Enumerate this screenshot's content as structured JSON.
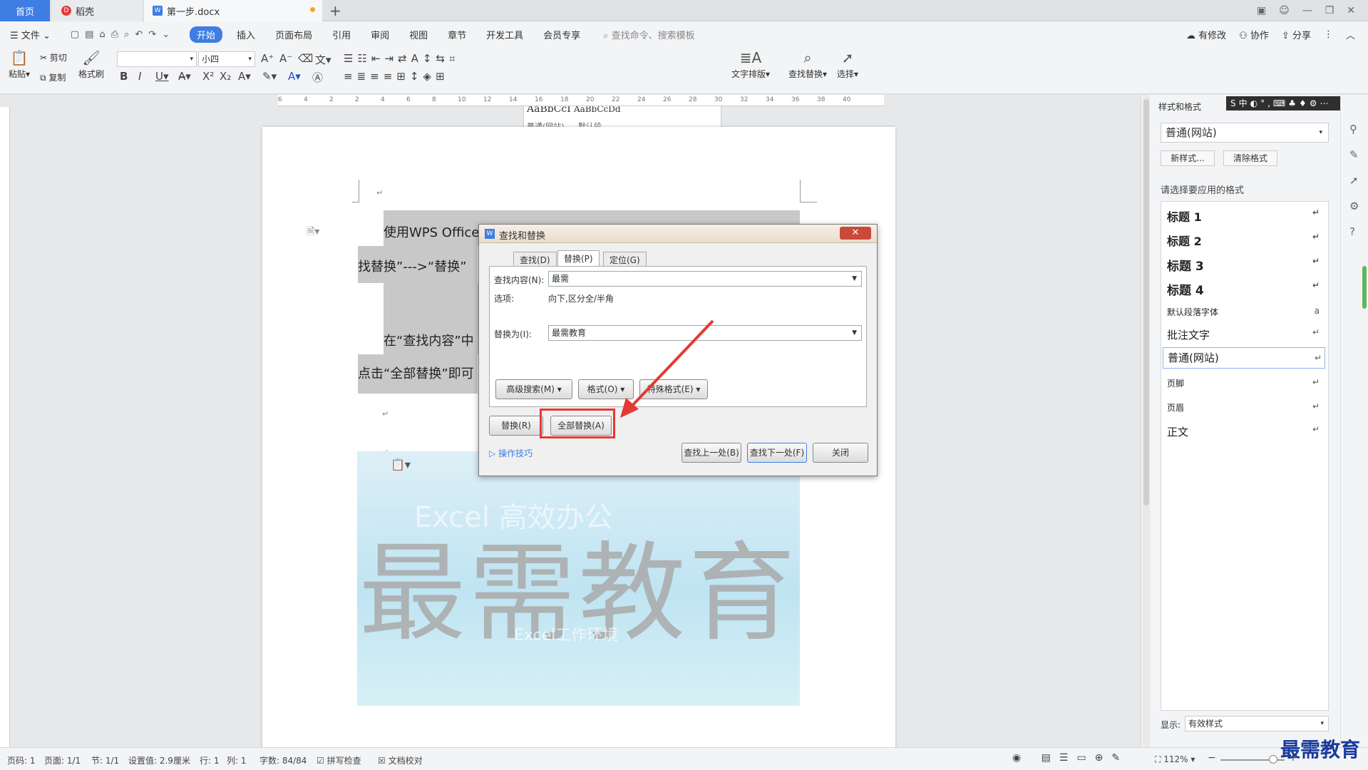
{
  "tabs": {
    "home": "首页",
    "daoke": "稻壳",
    "doc": "第一步.docx",
    "new_tab": "+"
  },
  "menu": {
    "file": "文件",
    "items": [
      "开始",
      "插入",
      "页面布局",
      "引用",
      "审阅",
      "视图",
      "章节",
      "开发工具",
      "会员专享"
    ],
    "search": "查找命令、搜索模板",
    "right": [
      "有修改",
      "协作",
      "分享"
    ]
  },
  "ribbon": {
    "paste": "粘贴",
    "cut": "剪切",
    "copy": "复制",
    "format_painter": "格式刷",
    "font_size": "小四",
    "style_samples": [
      {
        "sample": "AaBbCcI",
        "label": "普通(网站)"
      },
      {
        "sample": "AaBbCcDd",
        "label": "默认段..."
      }
    ],
    "text_layout": "文字排版",
    "find_replace": "查找替换",
    "select": "选择"
  },
  "ruler": [
    "6",
    "4",
    "2",
    "2",
    "4",
    "6",
    "8",
    "10",
    "12",
    "14",
    "16",
    "18",
    "20",
    "22",
    "24",
    "26",
    "28",
    "30",
    "32",
    "34",
    "36",
    "38",
    "40"
  ],
  "document": {
    "line1": "使用WPS Office",
    "line2": "找替换”--->“替换”",
    "line3": "在“查找内容”中",
    "line4": "点击“全部替换”即可",
    "image_text": "最需教育",
    "image_subtitle": "Excel 高效办公",
    "image_caption": "Excel工作环境"
  },
  "dialog": {
    "title": "查找和替换",
    "tabs": [
      "查找(D)",
      "替换(P)",
      "定位(G)"
    ],
    "find_label": "查找内容(N):",
    "find_value": "最需",
    "options_label": "选项:",
    "options_value": "向下,区分全/半角",
    "replace_label": "替换为(I):",
    "replace_value": "最需教育",
    "advanced": "高级搜索(M)",
    "format": "格式(O)",
    "special": "特殊格式(E)",
    "replace_btn": "替换(R)",
    "replace_all_btn": "全部替换(A)",
    "tips": "操作技巧",
    "find_prev": "查找上一处(B)",
    "find_next": "查找下一处(F)",
    "close": "关闭"
  },
  "panel": {
    "title": "样式和格式",
    "current_style": "普通(网站)",
    "new_style": "新样式...",
    "clear_format": "清除格式",
    "choose_label": "请选择要应用的格式",
    "styles": [
      "标题 1",
      "标题 2",
      "标题 3",
      "标题 4",
      "默认段落字体",
      "批注文字",
      "普通(网站)",
      "页脚",
      "页眉",
      "正文"
    ],
    "show_label": "显示:",
    "show_value": "有效样式"
  },
  "status": {
    "page_num": "页码: 1",
    "pages": "页面: 1/1",
    "section": "节: 1/1",
    "setting": "设置值: 2.9厘米",
    "row": "行: 1",
    "col": "列: 1",
    "words": "字数: 84/84",
    "spell": "拼写检查",
    "proof": "文档校对",
    "zoom": "112%"
  },
  "watermark": "最需教育",
  "colors": {
    "accent": "#3d7de4",
    "highlight": "#e53935",
    "arrow": "#e53935"
  }
}
